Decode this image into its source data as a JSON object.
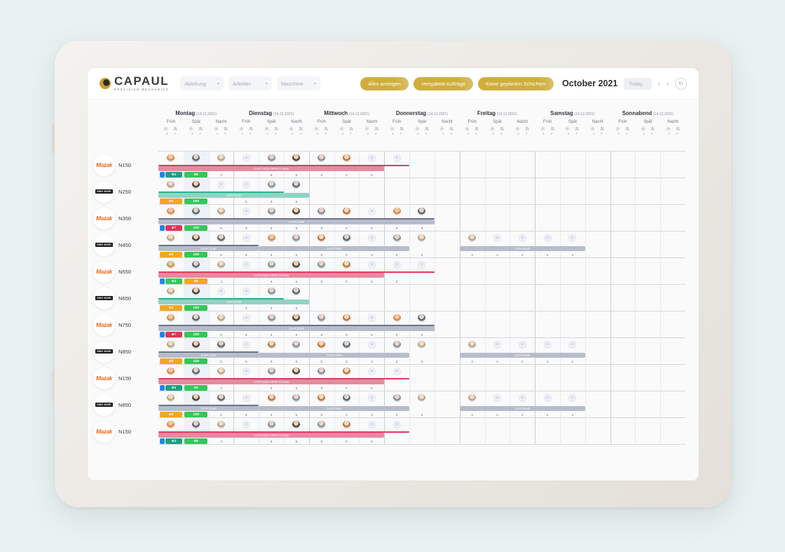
{
  "app": {
    "brand_name": "CAPAUL",
    "brand_tagline": "PRECISION MECHANICS",
    "accent_color": "#cfae3c"
  },
  "header": {
    "filters": [
      {
        "label": "Abteilung",
        "icon": "chevron-down-icon"
      },
      {
        "label": "Arbeiter",
        "icon": "chevron-down-icon"
      },
      {
        "label": "Maschine",
        "icon": "chevron-down-icon"
      }
    ],
    "pills": [
      {
        "label": "Alles anzeigen"
      },
      {
        "label": "Verspätete Aufträge"
      },
      {
        "label": "Keine geplanten Schichten"
      }
    ],
    "month_label": "October 2021",
    "today_label": "Today",
    "prev_label": "‹",
    "next_label": "›",
    "refresh_label": "↻"
  },
  "calendar": {
    "days": [
      {
        "name": "Montag",
        "date": "(14.12.2021)"
      },
      {
        "name": "Dienstag",
        "date": "(14.12.2021)"
      },
      {
        "name": "Mittwoch",
        "date": "(14.12.2021)"
      },
      {
        "name": "Donnerstag",
        "date": "(14.12.2021)"
      },
      {
        "name": "Freitag",
        "date": "(14.12.2021)"
      },
      {
        "name": "Samstag",
        "date": "(14.12.2021)"
      },
      {
        "name": "Sonnabend",
        "date": "(14.12.2021)"
      }
    ],
    "shifts": [
      "Früh",
      "Spät",
      "Nacht"
    ],
    "shift_capacity": {
      "machine_count": "4",
      "worker_count": "4"
    },
    "overflow_label": "···"
  },
  "machines": [
    {
      "brand": "Mazak",
      "name": "N150"
    },
    {
      "brand": "DMG MORI",
      "name": "N250"
    },
    {
      "brand": "Mazak",
      "name": "N350"
    },
    {
      "brand": "DMG MORI",
      "name": "N450"
    },
    {
      "brand": "Mazak",
      "name": "N550"
    },
    {
      "brand": "DMG MORI",
      "name": "N650"
    },
    {
      "brand": "Mazak",
      "name": "N750"
    },
    {
      "brand": "DMG MORI",
      "name": "N850"
    },
    {
      "brand": "Mazak",
      "name": "N150"
    },
    {
      "brand": "DMG MORI",
      "name": "N850"
    },
    {
      "brand": "Mazak",
      "name": "N150"
    }
  ],
  "orders": {
    "crosse": "CAPC1021-OP40-Crosse",
    "c1234": "CAPC1234",
    "c1360": "CAPC1360",
    "c7846": "CAPC7846",
    "c6945": "CAPC6945"
  },
  "colors": {
    "pink": "#e8899f",
    "pink_rail": "#dc3c63",
    "teal": "#8fd4c2",
    "teal_rail": "#2fae8e",
    "gray": "#b7bccb",
    "gray_rail": "#6b7589",
    "chip_green": "#35c759",
    "chip_teal": "#1f9e84",
    "chip_orange": "#f0a81e",
    "chip_red": "#e0335a",
    "chip_blue": "#1f86ea"
  },
  "rows": [
    {
      "machine": 0,
      "pattern": "crosse",
      "avatars": [
        "p0",
        "p1",
        "p2",
        "add",
        "p4",
        "p3",
        "p4",
        "p5",
        "add",
        "add",
        null,
        null,
        null,
        null,
        null,
        null,
        null,
        null,
        null,
        null,
        null
      ],
      "bar": {
        "label_key": "crosse",
        "kind": "pink",
        "start": 0,
        "span": 9,
        "rail_span": 10
      },
      "chips": [
        {
          "col": 0,
          "kind": "sq",
          "color": "chip_blue",
          "text": ""
        },
        {
          "col": 0,
          "text": "5/4",
          "color": "chip_teal",
          "offset": 1
        },
        {
          "col": 1,
          "text": "6/6",
          "color": "chip_green"
        }
      ],
      "nums": [
        null,
        null,
        "4",
        null,
        "6",
        "6",
        "6",
        "6",
        "6",
        null,
        null,
        null,
        null,
        null,
        null,
        null,
        null,
        null,
        null,
        null,
        null
      ]
    },
    {
      "machine": 1,
      "pattern": "teal",
      "avatars": [
        "p2",
        "p3",
        "add",
        "add",
        "p4",
        "p1",
        null,
        null,
        null,
        null,
        null,
        null,
        null,
        null,
        null,
        null,
        null,
        null,
        null,
        null,
        null
      ],
      "bar": {
        "label_key": "c1234",
        "kind": "teal",
        "start": 0,
        "span": 6,
        "rail_span": 5
      },
      "chips": [
        {
          "col": 0,
          "text": "9/9",
          "color": "chip_orange"
        },
        {
          "col": 1,
          "text": "10/9",
          "color": "chip_green"
        }
      ],
      "nums": [
        null,
        null,
        null,
        "5",
        "9",
        "9",
        null,
        null,
        null,
        null,
        null,
        null,
        null,
        null,
        null,
        null,
        null,
        null,
        null,
        null,
        null
      ]
    },
    {
      "machine": 2,
      "pattern": "gray",
      "avatars": [
        "p0",
        "p1",
        "p2",
        "add",
        "p4",
        "p3",
        "p4",
        "p5",
        "add",
        "p0",
        "p1",
        null,
        null,
        null,
        null,
        null,
        null,
        null,
        null,
        null,
        null
      ],
      "bar": {
        "label_key": "c1360",
        "kind": "gray",
        "start": 0,
        "span": 11,
        "rail_span": 11
      },
      "chips": [
        {
          "col": 0,
          "kind": "sq",
          "color": "chip_blue",
          "text": ""
        },
        {
          "col": 0,
          "text": "6/7",
          "color": "chip_red",
          "offset": 1
        },
        {
          "col": 1,
          "text": "11/9",
          "color": "chip_green"
        }
      ],
      "nums": [
        null,
        null,
        "9",
        "9",
        "9",
        "9",
        "9",
        "9",
        "9",
        "9",
        "9",
        null,
        null,
        null,
        null,
        null,
        null,
        null,
        null,
        null,
        null
      ]
    },
    {
      "machine": 3,
      "pattern": "multi",
      "avatars": [
        "p2",
        "p3",
        "p1",
        "add",
        "p0",
        "p4",
        "p5",
        "p1",
        "add",
        "p4",
        "p2",
        null,
        "p2",
        "add",
        "add",
        "add",
        "add",
        null,
        null,
        null,
        null
      ],
      "bars": [
        {
          "label_key": "c1360",
          "kind": "gray",
          "start": 0,
          "span": 4,
          "rail_span": 4
        },
        {
          "label_key": "c7846",
          "kind": "gray",
          "start": 4,
          "span": 6
        },
        {
          "label_key": "c6945",
          "kind": "gray",
          "start": 12,
          "span": 5
        }
      ],
      "chips": [
        {
          "col": 0,
          "text": "4/8",
          "color": "chip_orange"
        },
        {
          "col": 1,
          "text": "11/8",
          "color": "chip_green"
        }
      ],
      "nums": [
        null,
        null,
        "8",
        "8",
        "8",
        "5",
        "5",
        "5",
        "3",
        "5",
        "5",
        null,
        "4",
        "4",
        "4",
        "4",
        "4",
        null,
        null,
        null,
        null
      ]
    },
    {
      "machine": 4,
      "pattern": "crosse",
      "avatars": [
        "p0",
        "p1",
        "p2",
        "add",
        "p4",
        "p3",
        "p4",
        "p5",
        "add",
        "add",
        "add",
        null,
        null,
        null,
        null,
        null,
        null,
        null,
        null,
        null,
        null
      ],
      "bar": {
        "label_key": "crosse",
        "kind": "pink",
        "start": 0,
        "span": 9,
        "rail_span": 11
      },
      "chips": [
        {
          "col": 0,
          "kind": "sq",
          "color": "chip_blue",
          "text": ""
        },
        {
          "col": 0,
          "text": "5/4",
          "color": "chip_green",
          "offset": 1
        },
        {
          "col": 1,
          "text": "6/6",
          "color": "chip_orange"
        }
      ],
      "nums": [
        null,
        null,
        "4",
        null,
        "6",
        "6",
        "6",
        "6",
        "6",
        "6",
        null,
        null,
        null,
        null,
        null,
        null,
        null,
        null,
        null,
        null,
        null
      ]
    },
    {
      "machine": 5,
      "pattern": "teal",
      "avatars": [
        "p2",
        "p3",
        "add",
        "add",
        "p4",
        "p1",
        null,
        null,
        null,
        null,
        null,
        null,
        null,
        null,
        null,
        null,
        null,
        null,
        null,
        null,
        null
      ],
      "bar": {
        "label_key": "c1234",
        "kind": "teal",
        "start": 0,
        "span": 6,
        "rail_span": 5
      },
      "chips": [
        {
          "col": 0,
          "text": "9/9",
          "color": "chip_orange"
        },
        {
          "col": 1,
          "text": "10/9",
          "color": "chip_green"
        }
      ],
      "nums": [
        null,
        null,
        null,
        "5",
        "9",
        "9",
        null,
        null,
        null,
        null,
        null,
        null,
        null,
        null,
        null,
        null,
        null,
        null,
        null,
        null,
        null
      ]
    },
    {
      "machine": 6,
      "pattern": "gray",
      "avatars": [
        "p0",
        "p1",
        "p2",
        "add",
        "p4",
        "p3",
        "p4",
        "p5",
        "add",
        "p0",
        "p1",
        null,
        null,
        null,
        null,
        null,
        null,
        null,
        null,
        null,
        null
      ],
      "bar": {
        "label_key": "c1360",
        "kind": "gray",
        "start": 0,
        "span": 11,
        "rail_span": 11
      },
      "chips": [
        {
          "col": 0,
          "kind": "sq",
          "color": "chip_blue",
          "text": ""
        },
        {
          "col": 0,
          "text": "6/7",
          "color": "chip_red",
          "offset": 1
        },
        {
          "col": 1,
          "text": "11/9",
          "color": "chip_green"
        }
      ],
      "nums": [
        null,
        null,
        "9",
        "9",
        "9",
        "9",
        "9",
        "9",
        "9",
        "9",
        "9",
        null,
        null,
        null,
        null,
        null,
        null,
        null,
        null,
        null,
        null
      ]
    },
    {
      "machine": 7,
      "pattern": "multi",
      "avatars": [
        "p2",
        "p3",
        "p1",
        "add",
        "p5",
        "p4",
        "p5",
        "p1",
        "add",
        "p4",
        "p2",
        null,
        "p2",
        "add",
        "add",
        "add",
        "add",
        null,
        null,
        null,
        null
      ],
      "bars": [
        {
          "label_key": "c1360",
          "kind": "gray",
          "start": 0,
          "span": 4,
          "rail_span": 4
        },
        {
          "label_key": "c7846",
          "kind": "gray",
          "start": 4,
          "span": 6
        },
        {
          "label_key": "c6945",
          "kind": "gray",
          "start": 12,
          "span": 5
        }
      ],
      "chips": [
        {
          "col": 0,
          "text": "4/8",
          "color": "chip_orange"
        },
        {
          "col": 1,
          "text": "11/8",
          "color": "chip_green"
        }
      ],
      "nums": [
        null,
        null,
        "8",
        "8",
        "8",
        "5",
        "5",
        "5",
        "3",
        "5",
        "5",
        null,
        "4",
        "4",
        "4",
        "4",
        "4",
        null,
        null,
        null,
        null
      ]
    },
    {
      "machine": 8,
      "pattern": "crosse",
      "avatars": [
        "p0",
        "p1",
        "p2",
        "add",
        "p4",
        "p3",
        "p4",
        "p5",
        "add",
        "add",
        null,
        null,
        null,
        null,
        null,
        null,
        null,
        null,
        null,
        null,
        null
      ],
      "bar": {
        "label_key": "crosse",
        "kind": "pink",
        "start": 0,
        "span": 9,
        "rail_span": 10
      },
      "chips": [
        {
          "col": 0,
          "kind": "sq",
          "color": "chip_blue",
          "text": ""
        },
        {
          "col": 0,
          "text": "5/4",
          "color": "chip_teal",
          "offset": 1
        },
        {
          "col": 1,
          "text": "6/6",
          "color": "chip_green"
        }
      ],
      "nums": [
        null,
        null,
        "4",
        null,
        "6",
        "6",
        "6",
        "6",
        "6",
        null,
        null,
        null,
        null,
        null,
        null,
        null,
        null,
        null,
        null,
        null,
        null
      ]
    },
    {
      "machine": 9,
      "pattern": "multi",
      "avatars": [
        "p2",
        "p3",
        "p1",
        "add",
        "p5",
        "p4",
        "p5",
        "p1",
        "add",
        "p4",
        "p2",
        null,
        "p2",
        "add",
        "add",
        "add",
        "add",
        null,
        null,
        null,
        null
      ],
      "bars": [
        {
          "label_key": "c1360",
          "kind": "gray",
          "start": 0,
          "span": 4,
          "rail_span": 4
        },
        {
          "label_key": "c7846",
          "kind": "gray",
          "start": 4,
          "span": 6
        },
        {
          "label_key": "c6945",
          "kind": "gray",
          "start": 12,
          "span": 5
        }
      ],
      "chips": [
        {
          "col": 0,
          "text": "4/8",
          "color": "chip_orange"
        },
        {
          "col": 1,
          "text": "11/8",
          "color": "chip_green"
        }
      ],
      "nums": [
        null,
        null,
        "8",
        "8",
        "8",
        "5",
        "5",
        "5",
        "3",
        "5",
        "5",
        null,
        "4",
        "4",
        "4",
        "4",
        "4",
        null,
        null,
        null,
        null
      ]
    },
    {
      "machine": 10,
      "pattern": "crosse",
      "avatars": [
        "p0",
        "p1",
        "p2",
        "add",
        "p4",
        "p3",
        "p4",
        "p5",
        "add",
        "add",
        null,
        null,
        null,
        null,
        null,
        null,
        null,
        null,
        null,
        null,
        null
      ],
      "bar": {
        "label_key": "crosse",
        "kind": "pink",
        "start": 0,
        "span": 9,
        "rail_span": 10
      },
      "chips": [
        {
          "col": 0,
          "kind": "sq",
          "color": "chip_blue",
          "text": ""
        },
        {
          "col": 0,
          "text": "5/4",
          "color": "chip_teal",
          "offset": 1
        },
        {
          "col": 1,
          "text": "6/6",
          "color": "chip_green"
        }
      ],
      "nums": [
        null,
        null,
        "4",
        null,
        "6",
        "6",
        "6",
        "6",
        "6",
        null,
        null,
        null,
        null,
        null,
        null,
        null,
        null,
        null,
        null,
        null,
        null
      ]
    }
  ]
}
